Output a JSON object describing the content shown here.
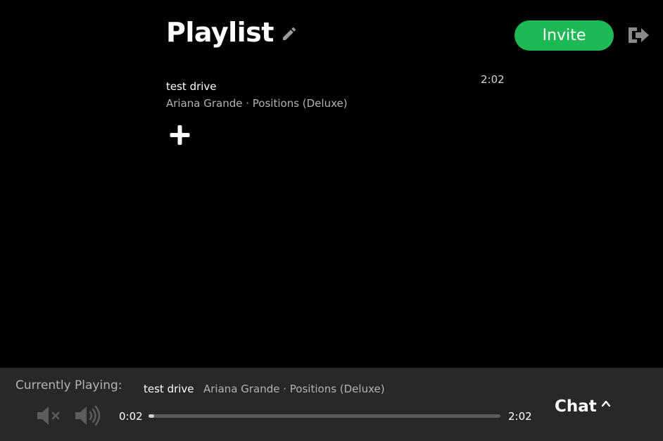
{
  "header": {
    "title": "Playlist",
    "edit_icon": "pencil-icon",
    "invite_label": "Invite",
    "logout_icon": "sign-out-icon"
  },
  "playlist": {
    "tracks": [
      {
        "title": "test drive",
        "meta": "Ariana Grande · Positions (Deluxe)",
        "duration": "2:02"
      }
    ],
    "add_icon": "plus-icon"
  },
  "player": {
    "label": "Currently Playing:",
    "title": "test drive",
    "meta": "Ariana Grande · Positions (Deluxe)",
    "current_time": "0:02",
    "total_time": "2:02",
    "progress_fraction": 0.016,
    "mute_icon": "volume-mute-icon",
    "volume_icon": "volume-up-icon"
  },
  "chat": {
    "label": "Chat",
    "toggle_icon": "chevron-up-icon"
  },
  "colors": {
    "accent": "#1db954",
    "background": "#000000",
    "player_bar": "#282828",
    "muted_text": "#b3b3b3"
  }
}
